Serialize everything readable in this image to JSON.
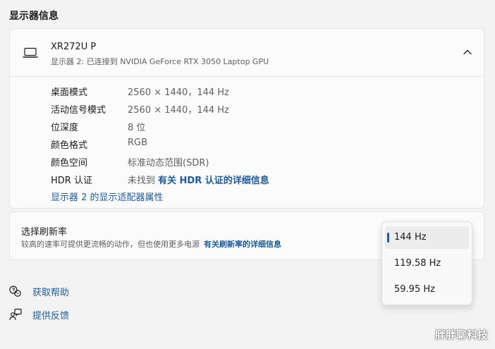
{
  "section": {
    "title": "显示器信息"
  },
  "display": {
    "name": "XR272U P",
    "subtitle": "显示器 2: 已连接到 NVIDIA GeForce RTX 3050 Laptop GPU",
    "icon": "laptop-icon",
    "collapse_icon": "chevron-up-icon",
    "rows": [
      {
        "key": "桌面模式",
        "value": "2560 × 1440，144 Hz"
      },
      {
        "key": "活动信号模式",
        "value": "2560 × 1440，144 Hz"
      },
      {
        "key": "位深度",
        "value": "8 位"
      },
      {
        "key": "颜色格式",
        "value": "RGB"
      },
      {
        "key": "颜色空间",
        "value": "标准动态范围(SDR)"
      },
      {
        "key": "HDR 认证",
        "value": "未找到",
        "link": "有关 HDR 认证的详细信息"
      }
    ],
    "adapter_link": "显示器 2 的显示适配器属性"
  },
  "refresh": {
    "title": "选择刷新率",
    "description": "较高的速率可提供更流畅的动作，但也使用更多电源",
    "link": "有关刷新率的详细信息",
    "options": [
      "144 Hz",
      "119.58 Hz",
      "59.95 Hz"
    ],
    "selected": "144 Hz"
  },
  "help": {
    "get_help": "获取帮助",
    "feedback": "提供反馈"
  },
  "watermark": "胖胖聊科技",
  "colors": {
    "background": "#f3f3f3",
    "card": "#fbfbfb",
    "link": "#1a5c9c",
    "accent": "#1a5c9c"
  }
}
